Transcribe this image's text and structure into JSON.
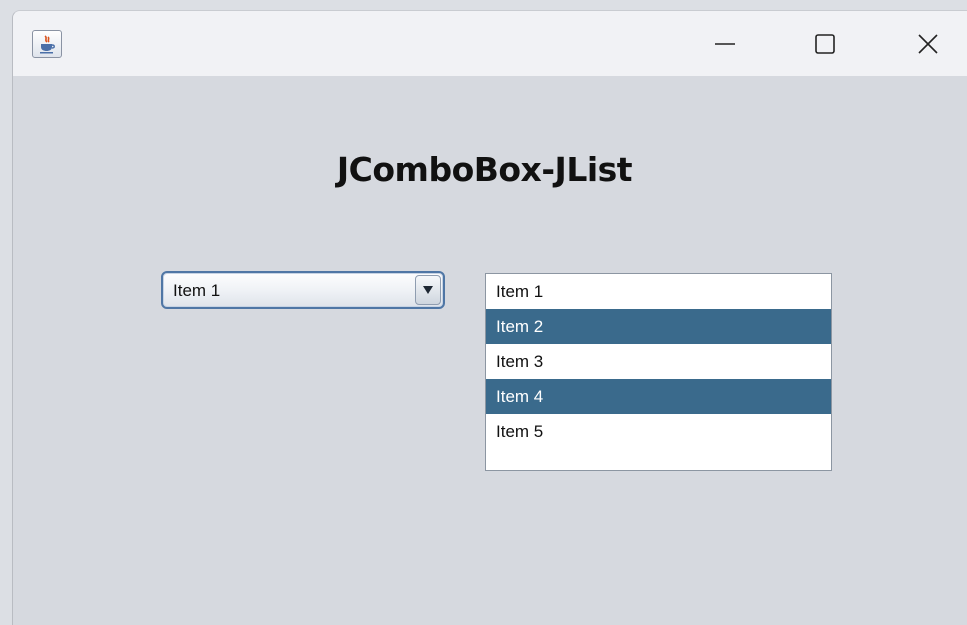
{
  "window": {
    "title": "",
    "controls": {
      "minimize_icon": "minimize-icon",
      "maximize_icon": "maximize-icon",
      "close_icon": "close-icon"
    },
    "app_icon": "java-cup-icon"
  },
  "content": {
    "heading": "JComboBox-JList",
    "combo": {
      "selected": "Item 1",
      "arrow_icon": "triangle-down-icon"
    },
    "list": {
      "items": [
        {
          "label": "Item 1",
          "selected": false
        },
        {
          "label": "Item 2",
          "selected": true
        },
        {
          "label": "Item 3",
          "selected": false
        },
        {
          "label": "Item 4",
          "selected": true
        },
        {
          "label": "Item 5",
          "selected": false
        }
      ]
    }
  },
  "colors": {
    "selection": "#3a6a8c",
    "combo_border": "#4f76a5",
    "panel_background": "#d6d9df"
  }
}
